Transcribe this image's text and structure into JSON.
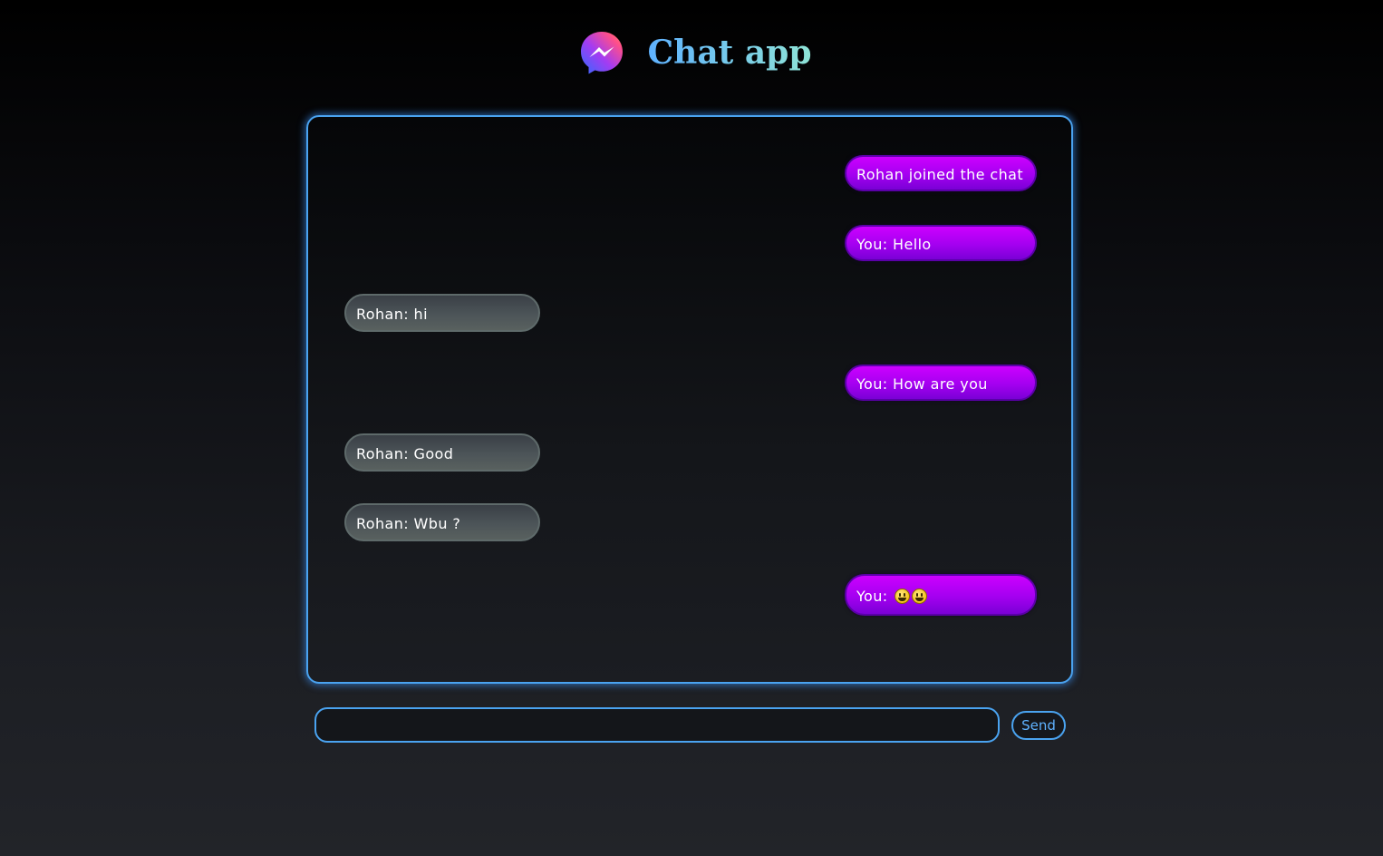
{
  "header": {
    "title": "Chat app",
    "logo_icon": "messenger-icon"
  },
  "messages": [
    {
      "direction": "outgoing",
      "text": "Rohan joined the chat"
    },
    {
      "direction": "outgoing",
      "text": "You: Hello"
    },
    {
      "direction": "incoming",
      "text": "Rohan: hi"
    },
    {
      "direction": "outgoing",
      "text": "You: How are you"
    },
    {
      "direction": "incoming",
      "text": "Rohan: Good"
    },
    {
      "direction": "incoming",
      "text": "Rohan: Wbu ?"
    },
    {
      "direction": "outgoing",
      "prefix": "You: ",
      "emoji_icons": [
        "grinning-face-emoji",
        "grinning-face-emoji"
      ]
    }
  ],
  "composer": {
    "input_value": "",
    "send_label": "Send"
  },
  "colors": {
    "accent": "#4aa3f0",
    "outgoing_bubble": "#a400f0",
    "incoming_bubble": "#4c5458",
    "title_gradient_start": "#5fb2ff",
    "title_gradient_end": "#8ee3d6"
  }
}
